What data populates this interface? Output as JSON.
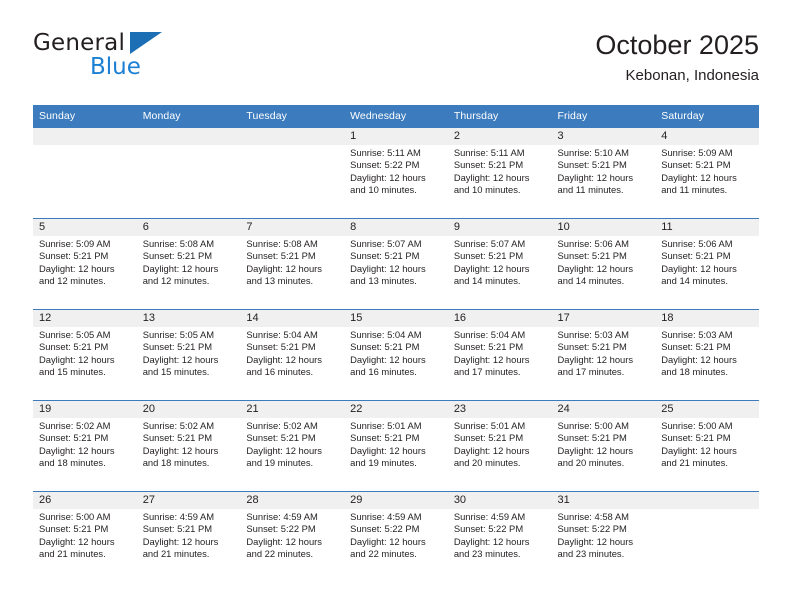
{
  "brand": {
    "name_part1": "General",
    "name_part2": "Blue",
    "triangle_color": "#1c6fb5",
    "blue_text_color": "#1b7fd4"
  },
  "header": {
    "title": "October 2025",
    "subtitle": "Kebonan, Indonesia"
  },
  "theme": {
    "header_blue": "#3c7cbe",
    "daynum_band": "#f0f0f0",
    "text": "#231f20"
  },
  "weekday_headers": [
    "Sunday",
    "Monday",
    "Tuesday",
    "Wednesday",
    "Thursday",
    "Friday",
    "Saturday"
  ],
  "labels": {
    "sunrise": "Sunrise:",
    "sunset": "Sunset:",
    "daylight": "Daylight:"
  },
  "weeks": [
    [
      {
        "day": "",
        "sunrise": "",
        "sunset": "",
        "daylight_line1": "",
        "daylight_line2": ""
      },
      {
        "day": "",
        "sunrise": "",
        "sunset": "",
        "daylight_line1": "",
        "daylight_line2": ""
      },
      {
        "day": "",
        "sunrise": "",
        "sunset": "",
        "daylight_line1": "",
        "daylight_line2": ""
      },
      {
        "day": "1",
        "sunrise": "Sunrise: 5:11 AM",
        "sunset": "Sunset: 5:22 PM",
        "daylight_line1": "Daylight: 12 hours",
        "daylight_line2": "and 10 minutes."
      },
      {
        "day": "2",
        "sunrise": "Sunrise: 5:11 AM",
        "sunset": "Sunset: 5:21 PM",
        "daylight_line1": "Daylight: 12 hours",
        "daylight_line2": "and 10 minutes."
      },
      {
        "day": "3",
        "sunrise": "Sunrise: 5:10 AM",
        "sunset": "Sunset: 5:21 PM",
        "daylight_line1": "Daylight: 12 hours",
        "daylight_line2": "and 11 minutes."
      },
      {
        "day": "4",
        "sunrise": "Sunrise: 5:09 AM",
        "sunset": "Sunset: 5:21 PM",
        "daylight_line1": "Daylight: 12 hours",
        "daylight_line2": "and 11 minutes."
      }
    ],
    [
      {
        "day": "5",
        "sunrise": "Sunrise: 5:09 AM",
        "sunset": "Sunset: 5:21 PM",
        "daylight_line1": "Daylight: 12 hours",
        "daylight_line2": "and 12 minutes."
      },
      {
        "day": "6",
        "sunrise": "Sunrise: 5:08 AM",
        "sunset": "Sunset: 5:21 PM",
        "daylight_line1": "Daylight: 12 hours",
        "daylight_line2": "and 12 minutes."
      },
      {
        "day": "7",
        "sunrise": "Sunrise: 5:08 AM",
        "sunset": "Sunset: 5:21 PM",
        "daylight_line1": "Daylight: 12 hours",
        "daylight_line2": "and 13 minutes."
      },
      {
        "day": "8",
        "sunrise": "Sunrise: 5:07 AM",
        "sunset": "Sunset: 5:21 PM",
        "daylight_line1": "Daylight: 12 hours",
        "daylight_line2": "and 13 minutes."
      },
      {
        "day": "9",
        "sunrise": "Sunrise: 5:07 AM",
        "sunset": "Sunset: 5:21 PM",
        "daylight_line1": "Daylight: 12 hours",
        "daylight_line2": "and 14 minutes."
      },
      {
        "day": "10",
        "sunrise": "Sunrise: 5:06 AM",
        "sunset": "Sunset: 5:21 PM",
        "daylight_line1": "Daylight: 12 hours",
        "daylight_line2": "and 14 minutes."
      },
      {
        "day": "11",
        "sunrise": "Sunrise: 5:06 AM",
        "sunset": "Sunset: 5:21 PM",
        "daylight_line1": "Daylight: 12 hours",
        "daylight_line2": "and 14 minutes."
      }
    ],
    [
      {
        "day": "12",
        "sunrise": "Sunrise: 5:05 AM",
        "sunset": "Sunset: 5:21 PM",
        "daylight_line1": "Daylight: 12 hours",
        "daylight_line2": "and 15 minutes."
      },
      {
        "day": "13",
        "sunrise": "Sunrise: 5:05 AM",
        "sunset": "Sunset: 5:21 PM",
        "daylight_line1": "Daylight: 12 hours",
        "daylight_line2": "and 15 minutes."
      },
      {
        "day": "14",
        "sunrise": "Sunrise: 5:04 AM",
        "sunset": "Sunset: 5:21 PM",
        "daylight_line1": "Daylight: 12 hours",
        "daylight_line2": "and 16 minutes."
      },
      {
        "day": "15",
        "sunrise": "Sunrise: 5:04 AM",
        "sunset": "Sunset: 5:21 PM",
        "daylight_line1": "Daylight: 12 hours",
        "daylight_line2": "and 16 minutes."
      },
      {
        "day": "16",
        "sunrise": "Sunrise: 5:04 AM",
        "sunset": "Sunset: 5:21 PM",
        "daylight_line1": "Daylight: 12 hours",
        "daylight_line2": "and 17 minutes."
      },
      {
        "day": "17",
        "sunrise": "Sunrise: 5:03 AM",
        "sunset": "Sunset: 5:21 PM",
        "daylight_line1": "Daylight: 12 hours",
        "daylight_line2": "and 17 minutes."
      },
      {
        "day": "18",
        "sunrise": "Sunrise: 5:03 AM",
        "sunset": "Sunset: 5:21 PM",
        "daylight_line1": "Daylight: 12 hours",
        "daylight_line2": "and 18 minutes."
      }
    ],
    [
      {
        "day": "19",
        "sunrise": "Sunrise: 5:02 AM",
        "sunset": "Sunset: 5:21 PM",
        "daylight_line1": "Daylight: 12 hours",
        "daylight_line2": "and 18 minutes."
      },
      {
        "day": "20",
        "sunrise": "Sunrise: 5:02 AM",
        "sunset": "Sunset: 5:21 PM",
        "daylight_line1": "Daylight: 12 hours",
        "daylight_line2": "and 18 minutes."
      },
      {
        "day": "21",
        "sunrise": "Sunrise: 5:02 AM",
        "sunset": "Sunset: 5:21 PM",
        "daylight_line1": "Daylight: 12 hours",
        "daylight_line2": "and 19 minutes."
      },
      {
        "day": "22",
        "sunrise": "Sunrise: 5:01 AM",
        "sunset": "Sunset: 5:21 PM",
        "daylight_line1": "Daylight: 12 hours",
        "daylight_line2": "and 19 minutes."
      },
      {
        "day": "23",
        "sunrise": "Sunrise: 5:01 AM",
        "sunset": "Sunset: 5:21 PM",
        "daylight_line1": "Daylight: 12 hours",
        "daylight_line2": "and 20 minutes."
      },
      {
        "day": "24",
        "sunrise": "Sunrise: 5:00 AM",
        "sunset": "Sunset: 5:21 PM",
        "daylight_line1": "Daylight: 12 hours",
        "daylight_line2": "and 20 minutes."
      },
      {
        "day": "25",
        "sunrise": "Sunrise: 5:00 AM",
        "sunset": "Sunset: 5:21 PM",
        "daylight_line1": "Daylight: 12 hours",
        "daylight_line2": "and 21 minutes."
      }
    ],
    [
      {
        "day": "26",
        "sunrise": "Sunrise: 5:00 AM",
        "sunset": "Sunset: 5:21 PM",
        "daylight_line1": "Daylight: 12 hours",
        "daylight_line2": "and 21 minutes."
      },
      {
        "day": "27",
        "sunrise": "Sunrise: 4:59 AM",
        "sunset": "Sunset: 5:21 PM",
        "daylight_line1": "Daylight: 12 hours",
        "daylight_line2": "and 21 minutes."
      },
      {
        "day": "28",
        "sunrise": "Sunrise: 4:59 AM",
        "sunset": "Sunset: 5:22 PM",
        "daylight_line1": "Daylight: 12 hours",
        "daylight_line2": "and 22 minutes."
      },
      {
        "day": "29",
        "sunrise": "Sunrise: 4:59 AM",
        "sunset": "Sunset: 5:22 PM",
        "daylight_line1": "Daylight: 12 hours",
        "daylight_line2": "and 22 minutes."
      },
      {
        "day": "30",
        "sunrise": "Sunrise: 4:59 AM",
        "sunset": "Sunset: 5:22 PM",
        "daylight_line1": "Daylight: 12 hours",
        "daylight_line2": "and 23 minutes."
      },
      {
        "day": "31",
        "sunrise": "Sunrise: 4:58 AM",
        "sunset": "Sunset: 5:22 PM",
        "daylight_line1": "Daylight: 12 hours",
        "daylight_line2": "and 23 minutes."
      },
      {
        "day": "",
        "sunrise": "",
        "sunset": "",
        "daylight_line1": "",
        "daylight_line2": ""
      }
    ]
  ]
}
